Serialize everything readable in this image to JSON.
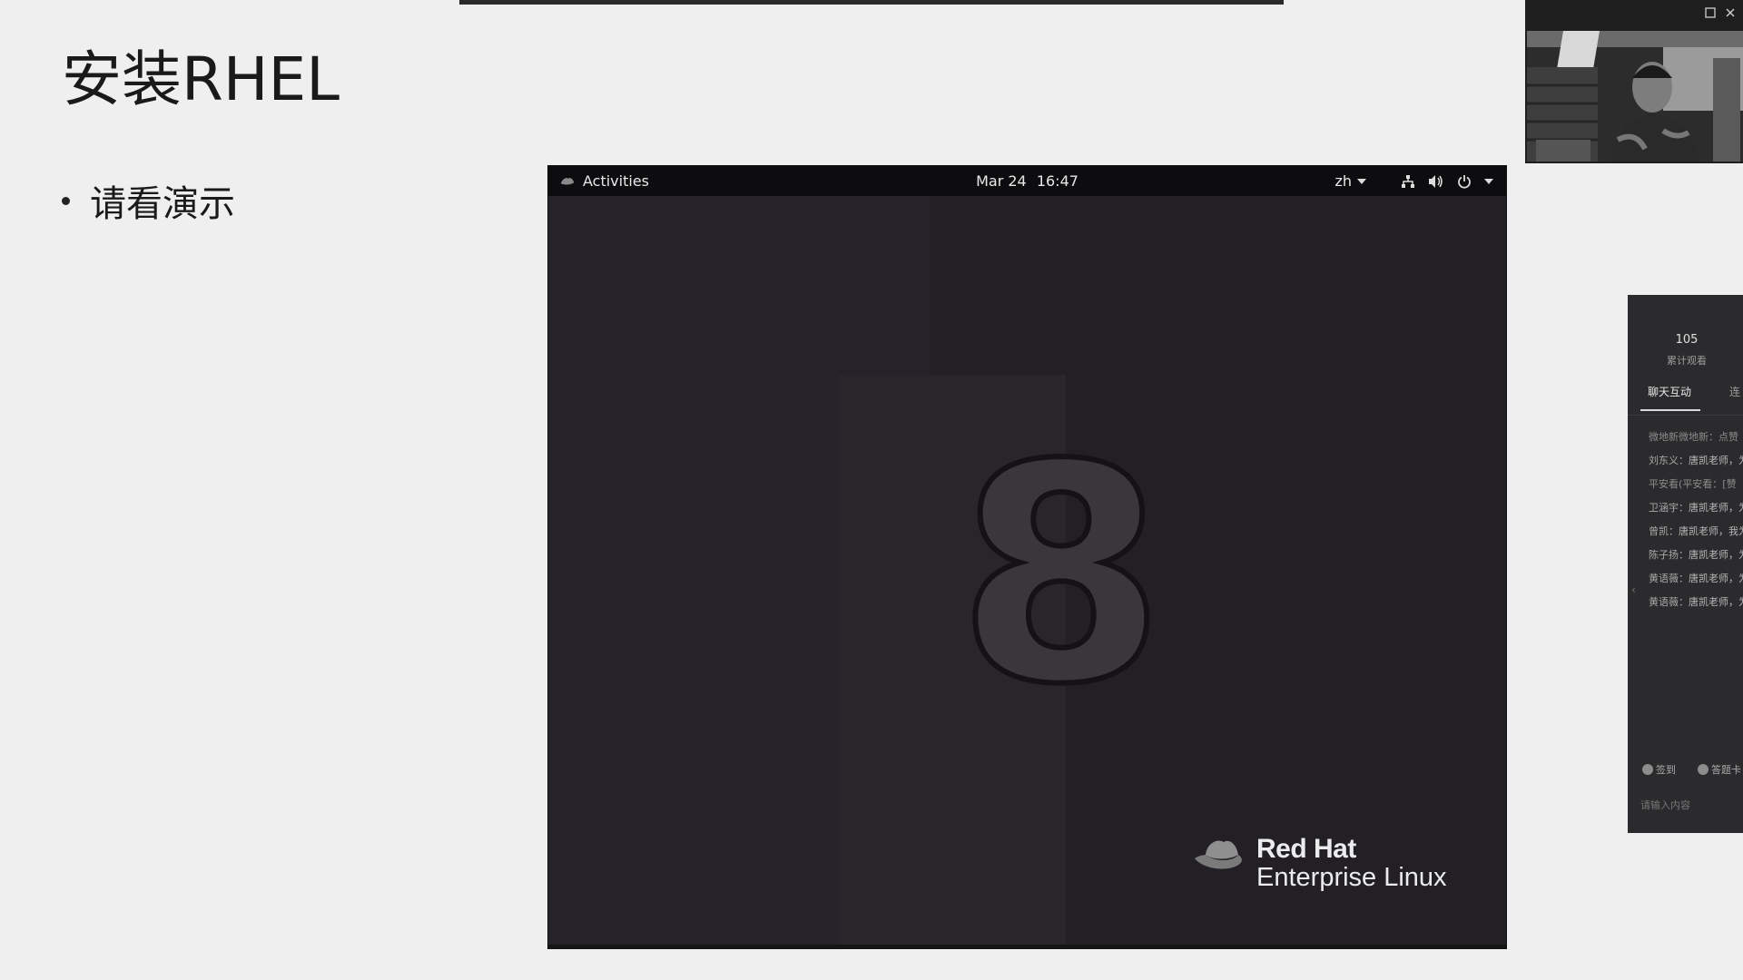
{
  "slide": {
    "title": "安装RHEL",
    "bullets": [
      "请看演示"
    ]
  },
  "vm": {
    "topbar": {
      "activities_label": "Activities",
      "date": "Mar 24",
      "time": "16:47",
      "language": "zh",
      "icons": [
        "red-hat-icon",
        "network-icon",
        "volume-icon",
        "power-icon",
        "chevron-down-icon"
      ]
    },
    "wallpaper": {
      "number": "8",
      "brand_line1": "Red Hat",
      "brand_line2": "Enterprise Linux"
    }
  },
  "webcam": {
    "controls": [
      "maximize-icon",
      "close-icon"
    ]
  },
  "live_panel": {
    "viewer_count": "105",
    "viewer_label": "累计观看",
    "tabs": [
      "聊天互动",
      "连"
    ],
    "messages": [
      {
        "text": "微地新微地新：点赞",
        "system": true
      },
      {
        "name": "刘东义：",
        "text": "唐凯老师，为你点赞!"
      },
      {
        "text": "平安看(平安看：[赞",
        "system": true
      },
      {
        "name": "卫涵宇：",
        "text": "唐凯老师，为你点赞!"
      },
      {
        "name": "曾凯：",
        "text": "唐凯老师，我为你点赞!"
      },
      {
        "name": "陈子扬：",
        "text": "唐凯老师，为你点赞!"
      },
      {
        "name": "黄语薇：",
        "text": "唐凯老师，为你点赞!"
      },
      {
        "name": "黄语薇：",
        "text": "唐凯老师，为你点赞!"
      }
    ],
    "actions": [
      "签到",
      "答题卡"
    ],
    "input_placeholder": "请输入内容"
  }
}
